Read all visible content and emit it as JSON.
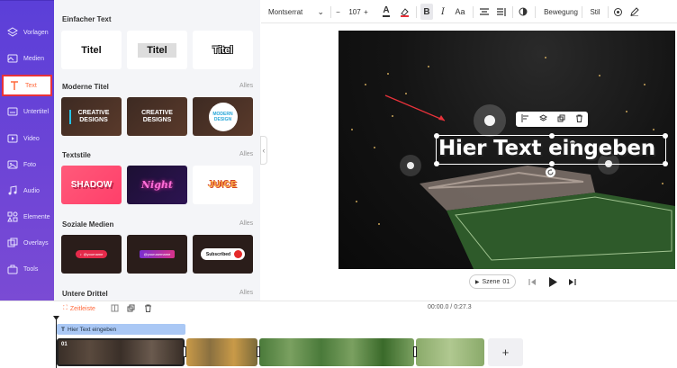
{
  "sidebar": {
    "items": [
      {
        "label": "Vorlagen",
        "icon": "templates-icon"
      },
      {
        "label": "Medien",
        "icon": "media-icon"
      },
      {
        "label": "Text",
        "icon": "text-icon"
      },
      {
        "label": "Untertitel",
        "icon": "subtitles-icon"
      },
      {
        "label": "Video",
        "icon": "video-icon"
      },
      {
        "label": "Foto",
        "icon": "photo-icon"
      },
      {
        "label": "Audio",
        "icon": "audio-icon"
      },
      {
        "label": "Elemente",
        "icon": "elements-icon"
      },
      {
        "label": "Overlays",
        "icon": "overlays-icon"
      },
      {
        "label": "Tools",
        "icon": "tools-icon"
      }
    ]
  },
  "panel": {
    "simple_text": {
      "title": "Einfacher Text",
      "cards": [
        "Titel",
        "Titel",
        "Titel"
      ]
    },
    "modern_titles": {
      "title": "Moderne Titel",
      "all": "Alles",
      "cards": [
        "CREATIVE DESIGNS",
        "CREATIVE DESIGNS",
        "MODERN DESIGN"
      ]
    },
    "text_styles": {
      "title": "Textstile",
      "all": "Alles",
      "cards": [
        "SHADOW",
        "Night",
        "JUICE"
      ]
    },
    "social_media": {
      "title": "Soziale Medien",
      "all": "Alles",
      "cards": [
        "@yourname",
        "@yourusername",
        "Subscribed"
      ]
    },
    "lower_thirds": {
      "title": "Untere Drittel",
      "all": "Alles"
    }
  },
  "toolbar": {
    "font": "Montserrat",
    "font_size": "107",
    "minus": "−",
    "plus": "+",
    "motion": "Bewegung",
    "style": "Stil"
  },
  "canvas": {
    "text_placeholder": "Hier Text eingeben"
  },
  "playback": {
    "scene_label": "Szene",
    "scene_number": "01"
  },
  "timeline": {
    "timeline_label": "Zeitleiste",
    "time_current": "00:00.0",
    "time_total": "0:27.3",
    "text_track_label": "Hier Text eingeben",
    "first_clip_number": "01",
    "add_label": "+"
  },
  "colors": {
    "accent": "#ff6a3d",
    "sidebar_top": "#5b3fd8",
    "selection_border": "#e8323a",
    "text_track": "#aac8f5"
  }
}
